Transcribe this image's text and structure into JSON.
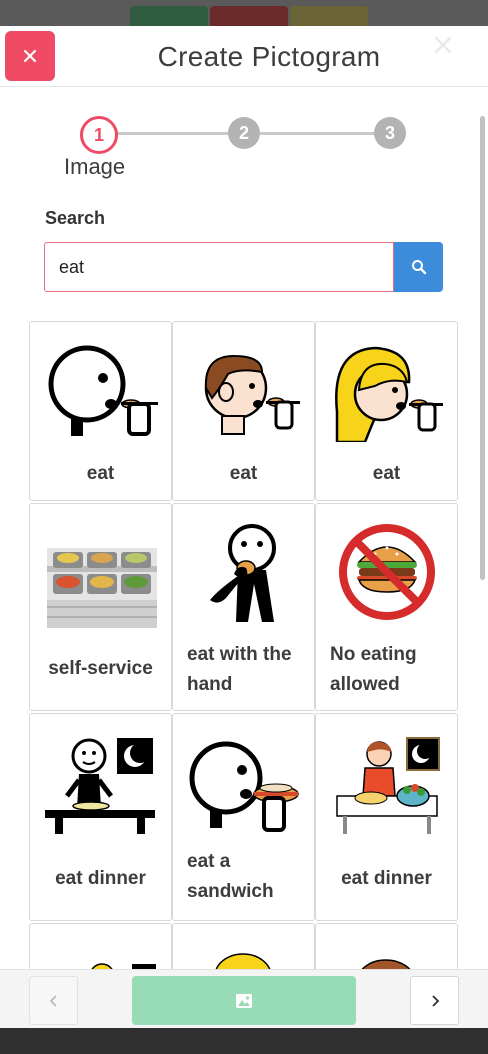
{
  "modal": {
    "title": "Create Pictogram",
    "close_icon": "close-icon"
  },
  "stepper": {
    "steps": [
      {
        "number": "1",
        "label": "Image",
        "state": "active"
      },
      {
        "number": "2",
        "label": "",
        "state": "inactive"
      },
      {
        "number": "3",
        "label": "",
        "state": "inactive"
      }
    ]
  },
  "search": {
    "label": "Search",
    "value": "eat",
    "button_icon": "search-icon"
  },
  "results": [
    {
      "label": "eat",
      "icon": "eat-outline-pictogram"
    },
    {
      "label": "eat",
      "icon": "eat-brown-hair-pictogram"
    },
    {
      "label": "eat",
      "icon": "eat-blonde-pictogram"
    },
    {
      "label": "self-service",
      "icon": "self-service-pictogram"
    },
    {
      "label": "eat with the hand",
      "icon": "eat-with-hand-pictogram"
    },
    {
      "label": "No eating allowed",
      "icon": "no-eating-pictogram"
    },
    {
      "label": "eat dinner",
      "icon": "eat-dinner-outline-pictogram"
    },
    {
      "label": "eat a sandwich",
      "icon": "eat-sandwich-pictogram"
    },
    {
      "label": "eat dinner",
      "icon": "eat-dinner-color-pictogram"
    }
  ],
  "footer": {
    "prev_icon": "chevron-left-icon",
    "main_icon": "image-icon",
    "next_icon": "chevron-right-icon"
  },
  "colors": {
    "accent_red": "#ef4b64",
    "search_blue": "#3d8cdb",
    "footer_green": "#97dcb7",
    "step_inactive": "#b3b3b3"
  }
}
